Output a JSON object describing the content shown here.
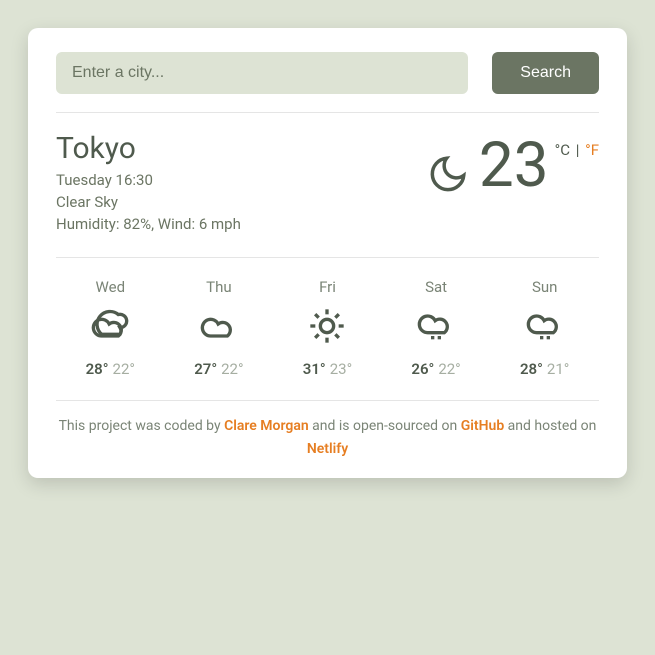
{
  "search": {
    "placeholder": "Enter a city...",
    "button": "Search"
  },
  "current": {
    "city": "Tokyo",
    "datetime": "Tuesday 16:30",
    "condition": "Clear Sky",
    "humidity_label": "Humidity",
    "humidity": "82%",
    "wind_label": "Wind",
    "wind": "6 mph",
    "temp": "23",
    "unit_c": "°C",
    "unit_sep": " | ",
    "unit_f": "°F",
    "icon": "moon"
  },
  "forecast": [
    {
      "day": "Wed",
      "icon": "cloud",
      "hi": "28°",
      "lo": "22°"
    },
    {
      "day": "Thu",
      "icon": "cloud",
      "hi": "27°",
      "lo": "22°"
    },
    {
      "day": "Fri",
      "icon": "sun",
      "hi": "31°",
      "lo": "23°"
    },
    {
      "day": "Sat",
      "icon": "rain",
      "hi": "26°",
      "lo": "22°"
    },
    {
      "day": "Sun",
      "icon": "rain",
      "hi": "28°",
      "lo": "21°"
    }
  ],
  "footer": {
    "t1": "This project was coded by ",
    "author": "Clare Morgan",
    "t2": " and is open-sourced on ",
    "repo": "GitHub",
    "t3": " and hosted on ",
    "host": "Netlify"
  }
}
